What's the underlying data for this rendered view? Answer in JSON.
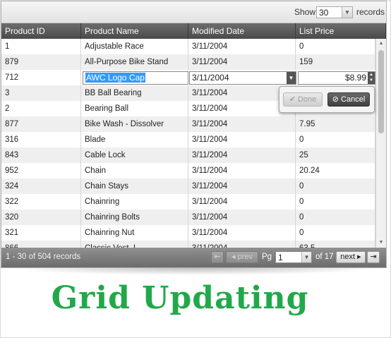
{
  "toolbar": {
    "show_label": "Show",
    "page_size": "30",
    "records_label": "records"
  },
  "columns": [
    "Product ID",
    "Product Name",
    "Modified Date",
    "List Price"
  ],
  "rows": [
    [
      "1",
      "Adjustable Race",
      "3/11/2004",
      "0"
    ],
    [
      "879",
      "All-Purpose Bike Stand",
      "3/11/2004",
      "159"
    ],
    [
      "712",
      "",
      "",
      ""
    ],
    [
      "3",
      "BB Ball Bearing",
      "3/11/2004",
      ""
    ],
    [
      "2",
      "Bearing Ball",
      "3/11/2004",
      ""
    ],
    [
      "877",
      "Bike Wash - Dissolver",
      "3/11/2004",
      "7.95"
    ],
    [
      "316",
      "Blade",
      "3/11/2004",
      "0"
    ],
    [
      "843",
      "Cable Lock",
      "3/11/2004",
      "25"
    ],
    [
      "952",
      "Chain",
      "3/11/2004",
      "20.24"
    ],
    [
      "324",
      "Chain Stays",
      "3/11/2004",
      "0"
    ],
    [
      "322",
      "Chainring",
      "3/11/2004",
      "0"
    ],
    [
      "320",
      "Chainring Bolts",
      "3/11/2004",
      "0"
    ],
    [
      "321",
      "Chainring Nut",
      "3/11/2004",
      "0"
    ],
    [
      "866",
      "Classic Vest, L",
      "3/11/2004",
      "63.5"
    ]
  ],
  "edit_row": {
    "name_value": "AWC Logo Cap",
    "date_value": "3/11/2004",
    "price_value": "$8.99"
  },
  "popup": {
    "done_label": "Done",
    "cancel_label": "Cancel"
  },
  "footer": {
    "records_info": "1 - 30 of 504 records",
    "prev_label": "prev",
    "pg_label": "Pg",
    "page_value": "1",
    "of_label": "of 17",
    "next_label": "next"
  },
  "title": "Grid Updating",
  "colors": {
    "title": "#22a84a",
    "header": "#4a4a4a"
  }
}
